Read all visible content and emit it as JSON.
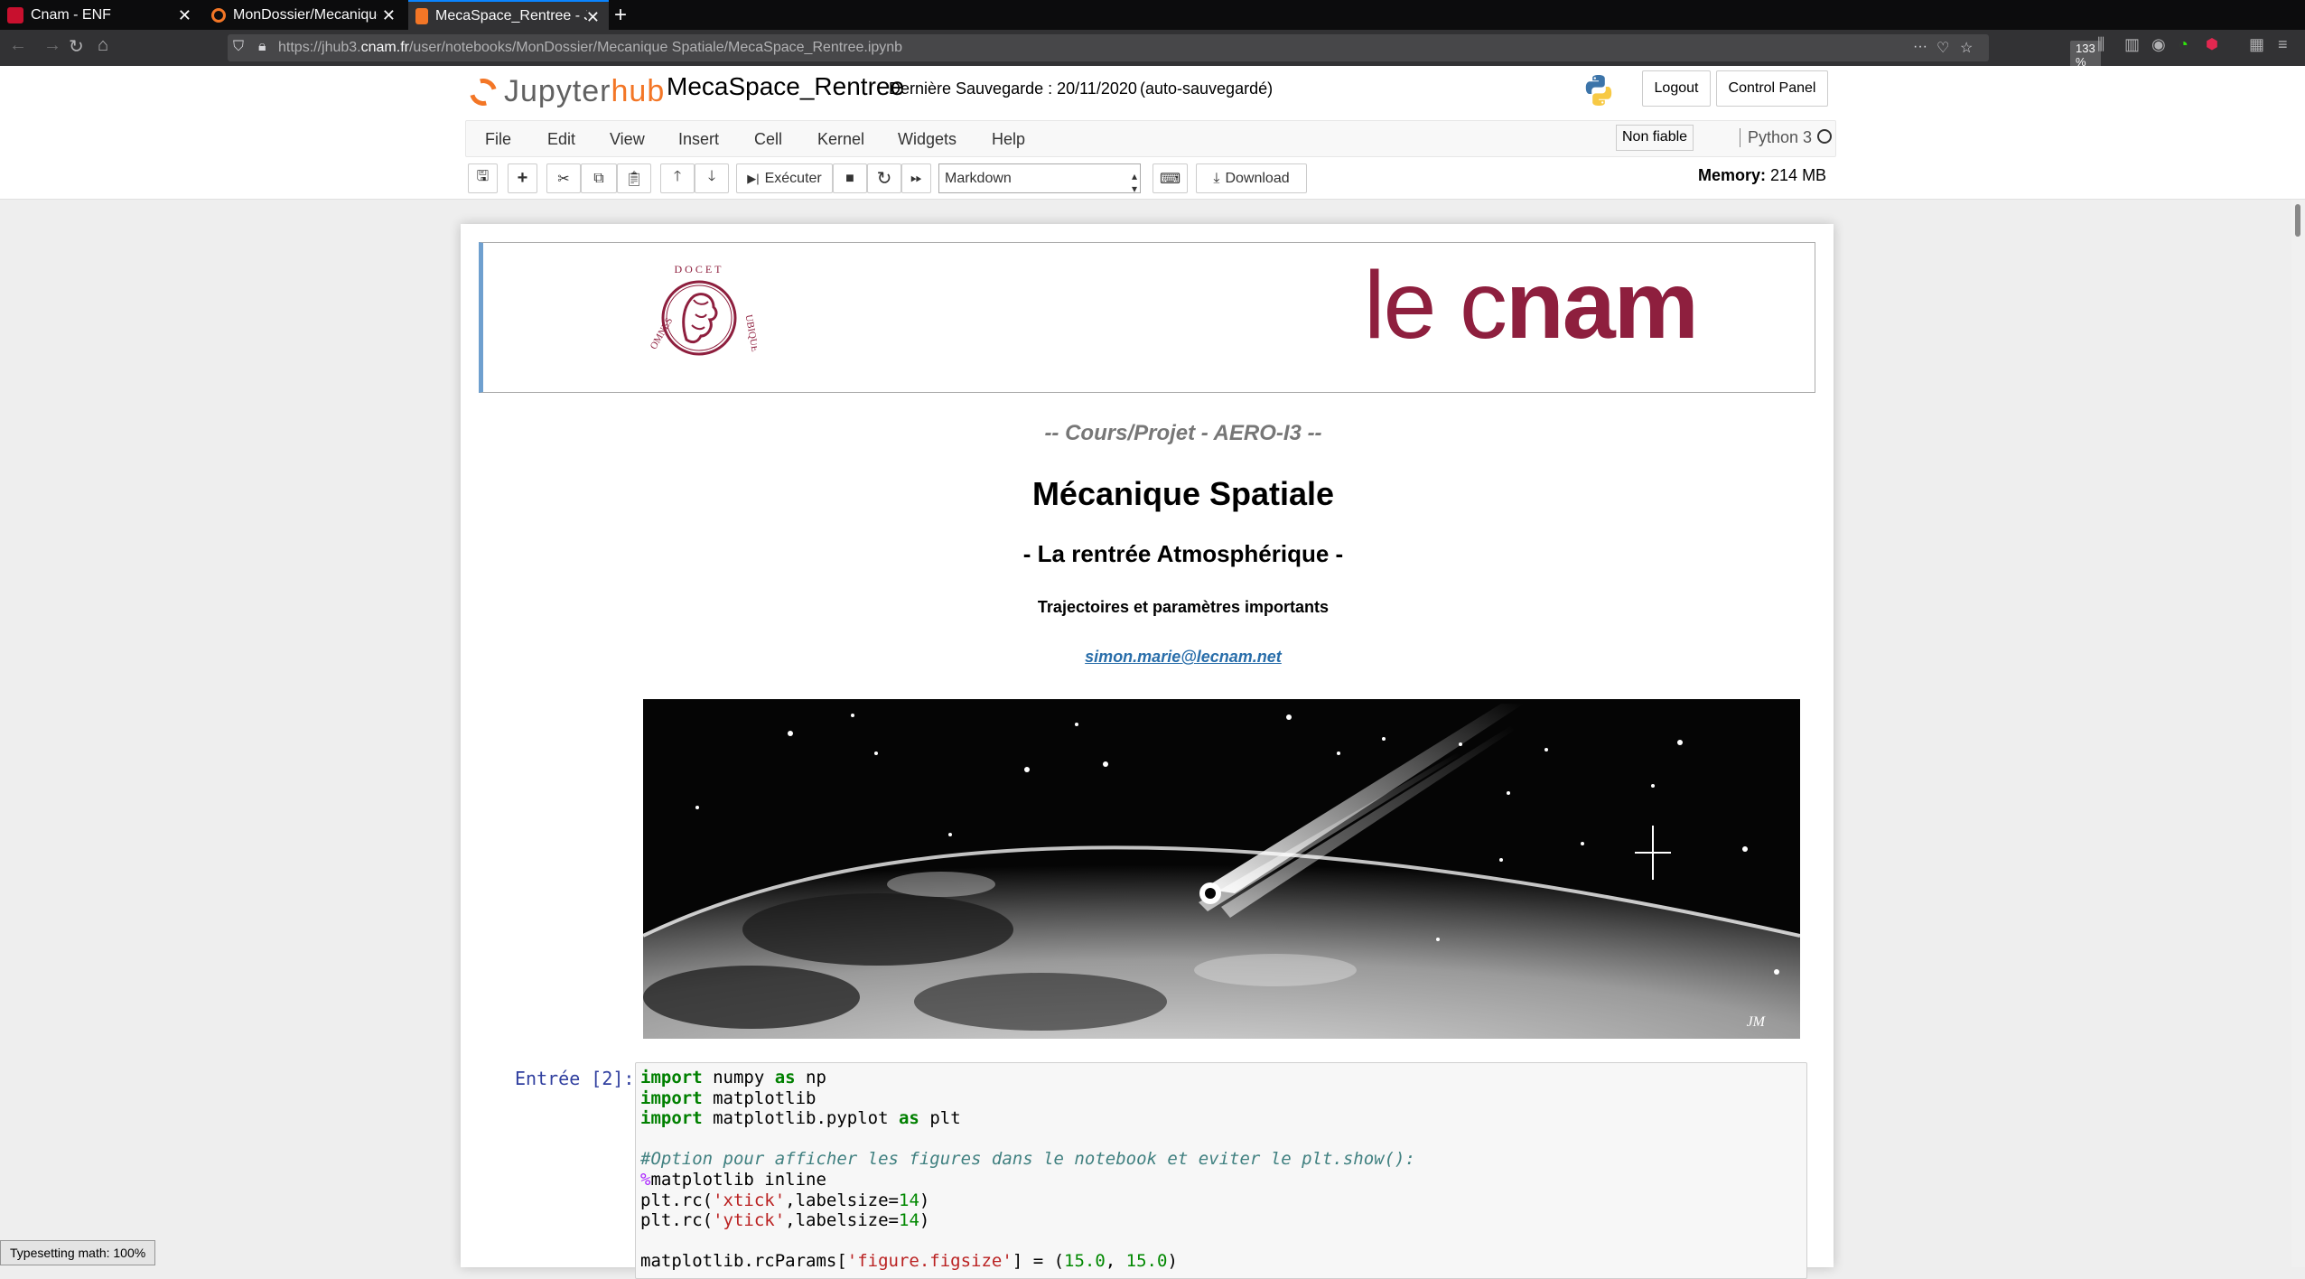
{
  "browser": {
    "tabs": [
      {
        "title": "Cnam - ENF",
        "favicon_color": "#c8102e"
      },
      {
        "title": "MonDossier/Mecanique",
        "favicon_color": "#f37626"
      },
      {
        "title": "MecaSpace_Rentree - J",
        "favicon_color": "#f37626"
      }
    ],
    "url_prefix": "https://jhub3.",
    "url_domain": "cnam.fr",
    "url_path": "/user/notebooks/MonDossier/Mecanique Spatiale/MecaSpace_Rentree.ipynb",
    "zoom": "133 %"
  },
  "jupyter": {
    "brand_prefix": "Jupyter",
    "brand_suffix": "hub",
    "notebook_name": "MecaSpace_Rentree",
    "last_save": "Dernière Sauvegarde : 20/11/2020",
    "autosaved": "(auto-sauvegardé)",
    "logout_label": "Logout",
    "control_panel_label": "Control Panel",
    "menu": [
      "File",
      "Edit",
      "View",
      "Insert",
      "Cell",
      "Kernel",
      "Widgets",
      "Help"
    ],
    "trust_label": "Non fiable",
    "kernel_name": "Python 3",
    "run_label": "Exécuter",
    "cell_type": "Markdown",
    "download_label": "Download",
    "memory_label": "Memory:",
    "memory_value": "214 MB"
  },
  "content": {
    "logo_thin": "le c",
    "logo_bold": "nam",
    "subtitle": "-- Cours/Projet - AERO-I3 --",
    "title": "Mécanique Spatiale",
    "heading2": "- La rentrée Atmosphérique -",
    "heading4": "Trajectoires et paramètres importants",
    "email": "simon.marie@lecnam.net",
    "image_signature": "JM"
  },
  "code_cell": {
    "prompt": "Entrée [2]:"
  },
  "status": {
    "typesetting": "Typesetting math: 100%"
  }
}
